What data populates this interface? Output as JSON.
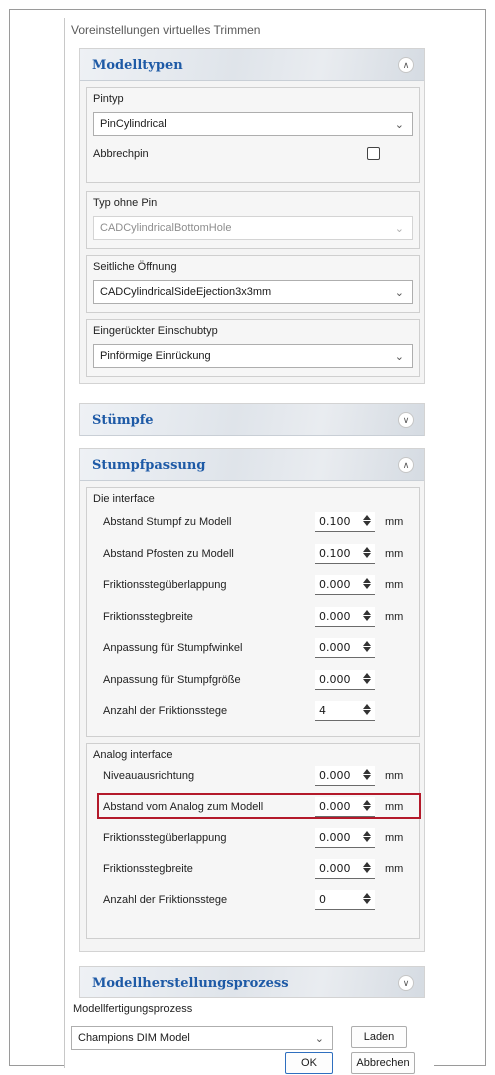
{
  "dialog": {
    "title": "Voreinstellungen virtuelles Trimmen"
  },
  "modelltypen": {
    "title": "Modelltypen",
    "toggle_icon": "chevron-double-up-icon",
    "pintyp": {
      "label": "Pintyp",
      "value": "PinCylindrical",
      "abbrechpin_label": "Abbrechpin",
      "abbrechpin_checked": false
    },
    "typ_ohne_pin": {
      "label": "Typ ohne Pin",
      "value": "CADCylindricalBottomHole"
    },
    "seitliche_oeffnung": {
      "label": "Seitliche Öffnung",
      "value": "CADCylindricalSideEjection3x3mm"
    },
    "einschubtyp": {
      "label": "Eingerückter Einschubtyp",
      "value": "Pinförmige Einrückung"
    }
  },
  "stuempfe": {
    "title": "Stümpfe",
    "toggle_icon": "chevron-double-down-icon"
  },
  "stumpfpassung": {
    "title": "Stumpfpassung",
    "toggle_icon": "chevron-double-up-icon",
    "die_interface": {
      "label": "Die interface",
      "rows": [
        {
          "label": "Abstand Stumpf zu Modell",
          "value": "0.100",
          "unit": "mm"
        },
        {
          "label": "Abstand Pfosten zu Modell",
          "value": "0.100",
          "unit": "mm"
        },
        {
          "label": "Friktionsstegüberlappung",
          "value": "0.000",
          "unit": "mm"
        },
        {
          "label": "Friktionsstegbreite",
          "value": "0.000",
          "unit": "mm"
        },
        {
          "label": "Anpassung für Stumpfwinkel",
          "value": "0.000",
          "unit": ""
        },
        {
          "label": "Anpassung für Stumpfgröße",
          "value": "0.000",
          "unit": ""
        },
        {
          "label": "Anzahl der Friktionsstege",
          "value": "4",
          "unit": ""
        }
      ]
    },
    "analog_interface": {
      "label": "Analog interface",
      "rows": [
        {
          "label": "Niveauausrichtung",
          "value": "0.000",
          "unit": "mm"
        },
        {
          "label": "Abstand vom Analog zum Modell",
          "value": "0.000",
          "unit": "mm"
        },
        {
          "label": "Friktionsstegüberlappung",
          "value": "0.000",
          "unit": "mm"
        },
        {
          "label": "Friktionsstegbreite",
          "value": "0.000",
          "unit": "mm"
        },
        {
          "label": "Anzahl der Friktionsstege",
          "value": "0",
          "unit": ""
        }
      ]
    }
  },
  "herstellung": {
    "title": "Modellherstellungsprozess",
    "toggle_icon": "chevron-double-down-icon",
    "label": "Modellfertigungsprozess",
    "value": "Champions DIM Model",
    "load_button": "Laden",
    "ok_button": "OK",
    "cancel_button": "Abbrechen"
  },
  "colors": {
    "section_title": "#1e5aa6",
    "highlight": "#b3192a"
  }
}
